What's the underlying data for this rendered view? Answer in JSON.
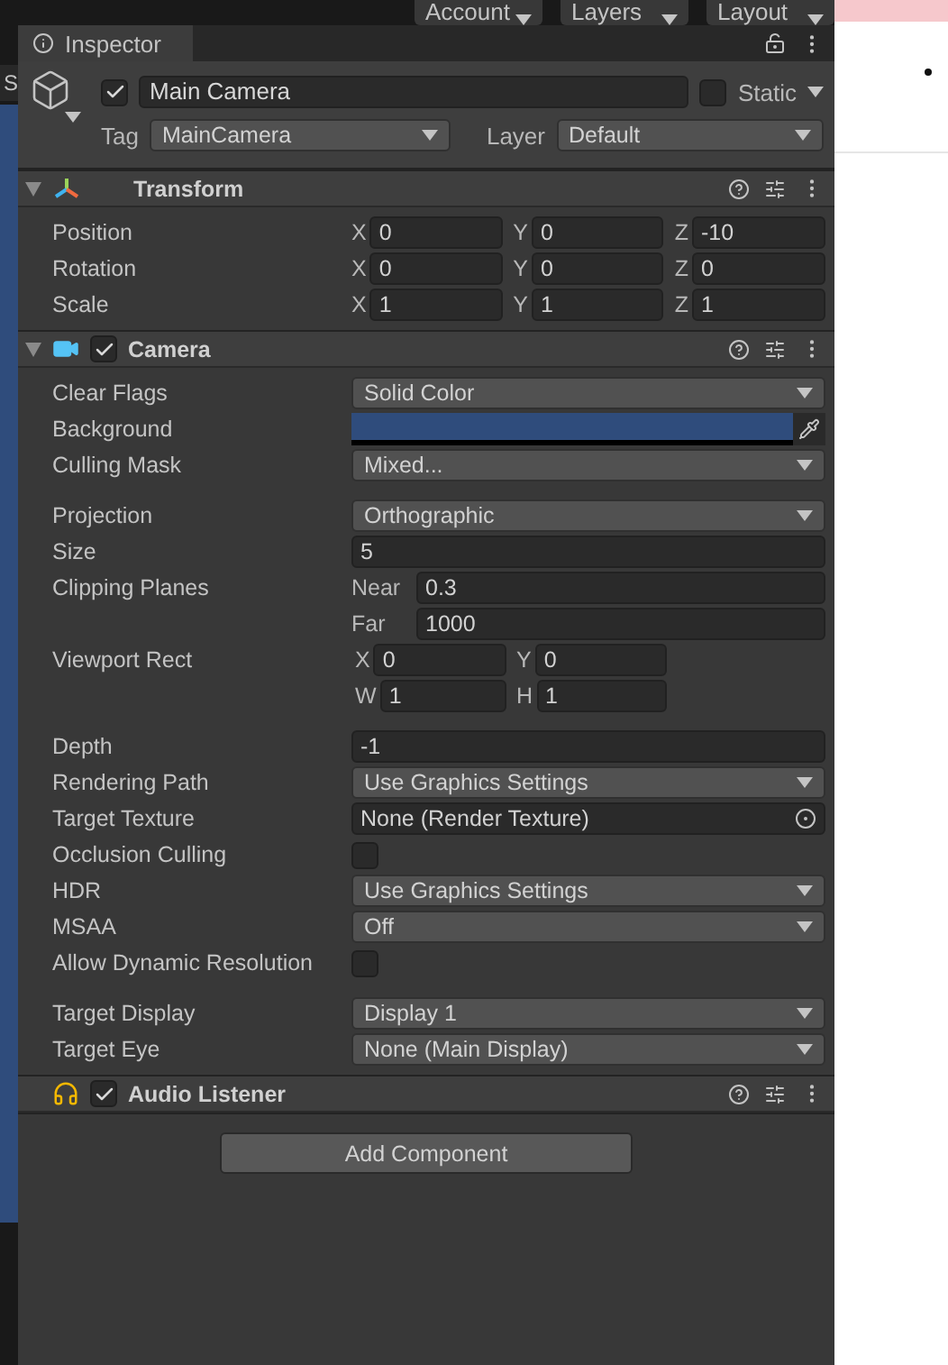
{
  "toolbar": {
    "buttons": [
      "Account",
      "Layers",
      "Layout"
    ]
  },
  "left_panel": {
    "label": "S"
  },
  "inspector": {
    "tab": "Inspector",
    "object": {
      "active": true,
      "name": "Main Camera",
      "static_label": "Static",
      "static": false,
      "tag_label": "Tag",
      "tag": "MainCamera",
      "layer_label": "Layer",
      "layer": "Default"
    }
  },
  "components": [
    {
      "name": "Transform",
      "kind": "transform",
      "expanded": true,
      "rows": [
        {
          "kind": "vector3",
          "label": "Position",
          "axes": [
            {
              "axis": "X",
              "value": "0"
            },
            {
              "axis": "Y",
              "value": "0"
            },
            {
              "axis": "Z",
              "value": "-10"
            }
          ]
        },
        {
          "kind": "vector3",
          "label": "Rotation",
          "axes": [
            {
              "axis": "X",
              "value": "0"
            },
            {
              "axis": "Y",
              "value": "0"
            },
            {
              "axis": "Z",
              "value": "0"
            }
          ]
        },
        {
          "kind": "vector3",
          "label": "Scale",
          "axes": [
            {
              "axis": "X",
              "value": "1"
            },
            {
              "axis": "Y",
              "value": "1"
            },
            {
              "axis": "Z",
              "value": "1"
            }
          ]
        }
      ]
    },
    {
      "name": "Camera",
      "kind": "camera",
      "enabled": true,
      "expanded": true,
      "rows": [
        {
          "kind": "dropdown",
          "label": "Clear Flags",
          "value": "Solid Color"
        },
        {
          "kind": "color",
          "label": "Background",
          "color": "#2f4c7c"
        },
        {
          "kind": "dropdown",
          "label": "Culling Mask",
          "value": "Mixed..."
        },
        {
          "kind": "spacer"
        },
        {
          "kind": "dropdown",
          "label": "Projection",
          "value": "Orthographic"
        },
        {
          "kind": "text",
          "label": "Size",
          "value": "5"
        },
        {
          "kind": "planes",
          "label": "Clipping Planes",
          "fields": [
            {
              "label": "Near",
              "value": "0.3"
            },
            {
              "label": "Far",
              "value": "1000"
            }
          ]
        },
        {
          "kind": "rect",
          "label": "Viewport Rect",
          "fields": [
            {
              "label": "X",
              "value": "0"
            },
            {
              "label": "Y",
              "value": "0"
            },
            {
              "label": "W",
              "value": "1"
            },
            {
              "label": "H",
              "value": "1"
            }
          ]
        },
        {
          "kind": "spacer"
        },
        {
          "kind": "text",
          "label": "Depth",
          "value": "-1"
        },
        {
          "kind": "dropdown",
          "label": "Rendering Path",
          "value": "Use Graphics Settings"
        },
        {
          "kind": "object",
          "label": "Target Texture",
          "value": "None (Render Texture)"
        },
        {
          "kind": "checkbox",
          "label": "Occlusion Culling",
          "checked": false
        },
        {
          "kind": "dropdown",
          "label": "HDR",
          "value": "Use Graphics Settings"
        },
        {
          "kind": "dropdown",
          "label": "MSAA",
          "value": "Off"
        },
        {
          "kind": "checkbox",
          "label": "Allow Dynamic Resolution",
          "checked": false
        },
        {
          "kind": "spacer"
        },
        {
          "kind": "dropdown",
          "label": "Target Display",
          "value": "Display 1"
        },
        {
          "kind": "dropdown",
          "label": "Target Eye",
          "value": "None (Main Display)"
        }
      ]
    },
    {
      "name": "Audio Listener",
      "kind": "audio",
      "enabled": true
    }
  ],
  "add_button": "Add Component"
}
